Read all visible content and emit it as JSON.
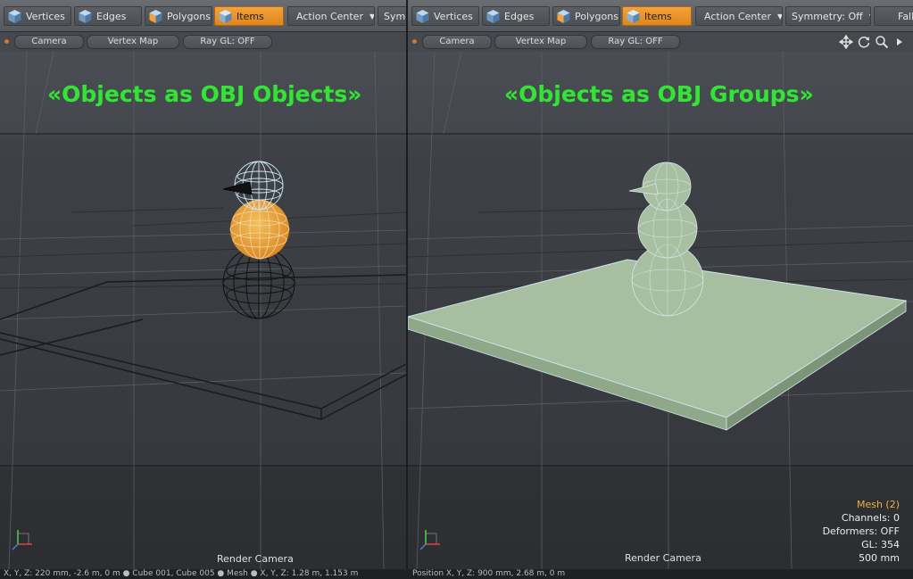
{
  "left_pane": {
    "toolbar": {
      "vertices": "Vertices",
      "edges": "Edges",
      "polygons": "Polygons",
      "items": "Items",
      "action_center": "Action Center",
      "symmetry_cut": "Symm"
    },
    "view_header": {
      "camera": "Camera",
      "vertex_map": "Vertex Map",
      "ray_gl": "Ray GL: OFF"
    },
    "caption": "«Objects as OBJ Objects»",
    "render_camera": "Render Camera",
    "status": "X, Y, Z:  220 mm, -2.6 m, 0 m  ●  Cube 001, Cube 005  ●  Mesh  ●  X, Y, Z:  1.28 m, 1.153 m"
  },
  "right_pane": {
    "toolbar": {
      "vertices": "Vertices",
      "edges": "Edges",
      "polygons": "Polygons",
      "items": "Items",
      "action_center": "Action Center",
      "symmetry": "Symmetry: Off",
      "falloff_cut": "Fall"
    },
    "view_header": {
      "camera": "Camera",
      "vertex_map": "Vertex Map",
      "ray_gl": "Ray GL: OFF"
    },
    "caption": "«Objects as OBJ Groups»",
    "render_camera": "Render Camera",
    "info": {
      "mesh": "Mesh (2)",
      "channels": "Channels: 0",
      "deformers": "Deformers: OFF",
      "gl": "GL: 354",
      "scale": "500 mm"
    },
    "status": "Position X, Y, Z:  900 mm, 2.68 m, 0 m"
  },
  "icons": {
    "vertices": "vertices-cube-icon",
    "edges": "edges-cube-icon",
    "polygons": "polygons-cube-icon",
    "items": "items-cube-icon",
    "move": "move-arrows-icon",
    "rotate": "rotate-view-icon",
    "zoom": "zoom-magnifier-icon",
    "more": "more-arrow-icon"
  },
  "colors": {
    "caption": "#36e23a",
    "active_tool": "#f0982e",
    "selection": "#f0b240",
    "mesh_fill": "#a7bea0"
  }
}
